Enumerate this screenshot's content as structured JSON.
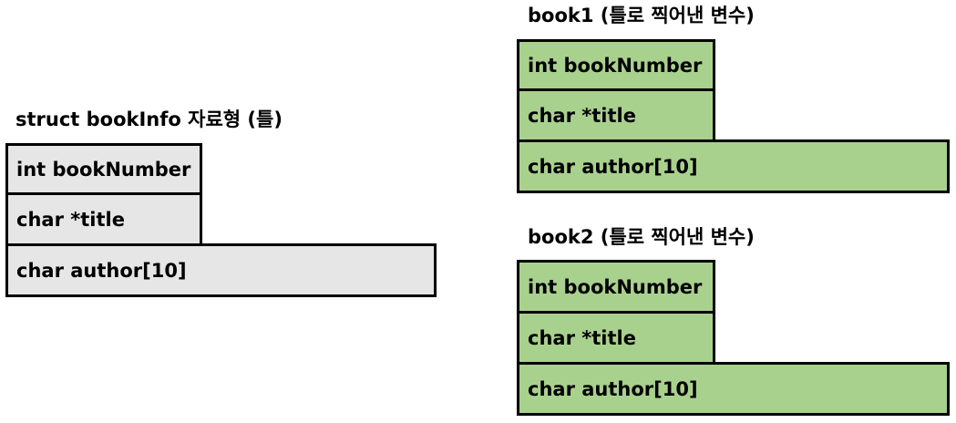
{
  "template": {
    "caption": "struct bookInfo 자료형 (틀)",
    "fields": [
      "int bookNumber",
      "char *title",
      "char author[10]"
    ],
    "fill_color": "#e6e6e6"
  },
  "book1": {
    "caption": "book1 (틀로 찍어낸 변수)",
    "fields": [
      "int bookNumber",
      "char *title",
      "char author[10]"
    ],
    "fill_color": "#a9d18e"
  },
  "book2": {
    "caption": "book2 (틀로 찍어낸 변수)",
    "fields": [
      "int bookNumber",
      "char *title",
      "char author[10]"
    ],
    "fill_color": "#a9d18e"
  }
}
